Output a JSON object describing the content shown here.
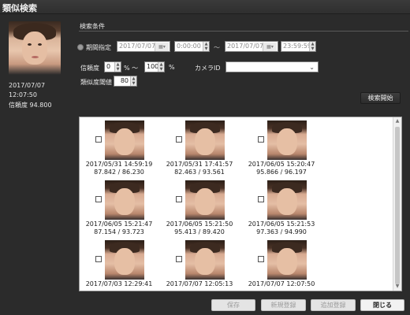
{
  "window": {
    "title": "類似検索"
  },
  "query": {
    "date": "2017/07/07",
    "time": "12:07:50",
    "confidence_label": "信頼度 94.800"
  },
  "search_conditions": {
    "section_label": "検索条件",
    "period_label": "期間指定",
    "start_date": "2017/07/07",
    "start_time": "0:00:00",
    "range_sep": "〜",
    "end_date": "2017/07/07",
    "end_time": "23:59:59",
    "confidence_label": "信頼度",
    "confidence_min": "0",
    "confidence_max": "100",
    "percent_unit": "%",
    "percent_range_text": "% 〜",
    "camera_id_label": "カメラID",
    "camera_id_value": "",
    "similarity_threshold_label": "類似度閾値",
    "similarity_threshold_value": "80",
    "search_button": "検索開始"
  },
  "icons": {
    "calendar": "calendar-icon",
    "spin_up": "▲",
    "spin_down": "▼",
    "dropdown": "chevron-down-icon"
  },
  "results": [
    {
      "line1": "2017/05/31 14:59:19",
      "line2": "87.842 / 86.230"
    },
    {
      "line1": "2017/05/31 17:41:57",
      "line2": "82.463 / 93.561"
    },
    {
      "line1": "2017/06/05 15:20:47",
      "line2": "95.866 / 96.197"
    },
    {
      "line1": "2017/06/05 15:21:47",
      "line2": "87.154 / 93.723"
    },
    {
      "line1": "2017/06/05 15:21:50",
      "line2": "95.413 / 89.420"
    },
    {
      "line1": "2017/06/05 15:21:53",
      "line2": "97.363 / 94.990"
    },
    {
      "line1": "2017/07/03 12:29:41",
      "line2": ""
    },
    {
      "line1": "2017/07/07 12:05:13",
      "line2": ""
    },
    {
      "line1": "2017/07/07 12:07:50",
      "line2": ""
    }
  ],
  "footer_buttons": {
    "save": "保存",
    "new_register": "新規登録",
    "add_register": "追加登録",
    "close": "閉じる"
  },
  "colors": {
    "background": "#2b2b2b",
    "panel_white": "#ffffff",
    "text_light": "#e8e8e8"
  }
}
